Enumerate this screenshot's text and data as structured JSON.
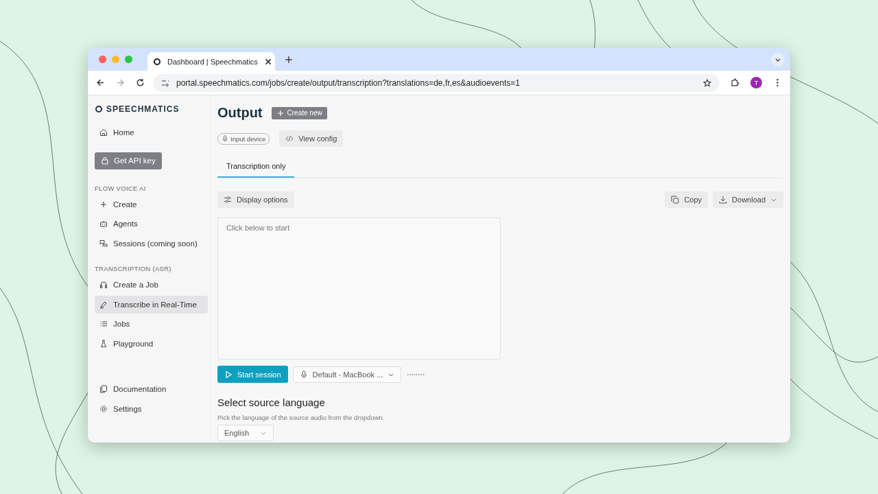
{
  "browser": {
    "tab_title": "Dashboard | Speechmatics",
    "url": "portal.speechmatics.com/jobs/create/output/transcription?translations=de,fr,es&audioevents=1",
    "avatar": "T"
  },
  "sidebar": {
    "brand": "SPEECHMATICS",
    "top_items": [
      {
        "label": "Home",
        "selected": false
      }
    ],
    "api_button": "Get API key",
    "sections": [
      {
        "title": "FLOW VOICE AI",
        "items": [
          {
            "label": "Create",
            "selected": false
          },
          {
            "label": "Agents",
            "selected": false
          },
          {
            "label": "Sessions (coming soon)",
            "selected": false
          }
        ]
      },
      {
        "title": "TRANSCRIPTION (ASR)",
        "items": [
          {
            "label": "Create a Job",
            "selected": false
          },
          {
            "label": "Transcribe in Real-Time",
            "selected": true
          },
          {
            "label": "Jobs",
            "selected": false
          },
          {
            "label": "Playground",
            "selected": false
          }
        ]
      }
    ],
    "footer_items": [
      {
        "label": "Documentation",
        "selected": false
      },
      {
        "label": "Settings",
        "selected": false
      }
    ]
  },
  "main": {
    "title": "Output",
    "create_button": "Create new",
    "input_device": "Input device",
    "view_config": "View config",
    "tabs": [
      {
        "label": "Transcription only",
        "selected": true
      }
    ],
    "display_options": "Display options",
    "copy": "Copy",
    "download": "Download",
    "transcript": {
      "placeholder": "Click below to start"
    },
    "start_session": "Start session",
    "microphone": "Default - MacBook ...",
    "language_heading": "Select source language",
    "language_hint": "Pick the language of the source audio from the dropdown.",
    "language": "English"
  }
}
